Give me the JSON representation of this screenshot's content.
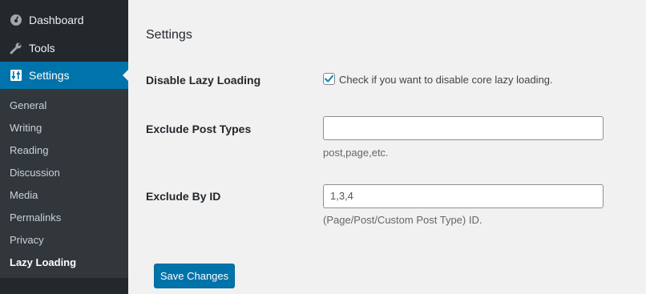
{
  "sidebar": {
    "top_items": [
      {
        "label": "Dashboard",
        "icon": "dashboard-icon"
      },
      {
        "label": "Tools",
        "icon": "wrench-icon"
      },
      {
        "label": "Settings",
        "icon": "settings-icon"
      }
    ],
    "submenu": [
      "General",
      "Writing",
      "Reading",
      "Discussion",
      "Media",
      "Permalinks",
      "Privacy",
      "Lazy Loading"
    ],
    "active_submenu": "Lazy Loading"
  },
  "main": {
    "title": "Settings",
    "disable_lazy": {
      "label": "Disable Lazy Loading",
      "checked": true,
      "checkbox_text": "Check if you want to disable core lazy loading."
    },
    "exclude_post_types": {
      "label": "Exclude Post Types",
      "value": "",
      "description": "post,page,etc."
    },
    "exclude_by_id": {
      "label": "Exclude By ID",
      "value": "1,3,4",
      "description": "(Page/Post/Custom Post Type) ID."
    },
    "save_label": "Save Changes"
  },
  "colors": {
    "sidebar_bg": "#23282d",
    "submenu_bg": "#32373c",
    "accent": "#0073aa",
    "page_bg": "#f1f1f1"
  }
}
